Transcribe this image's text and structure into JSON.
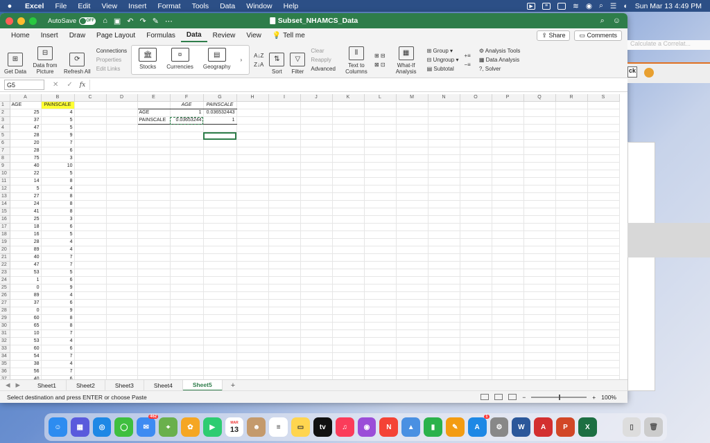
{
  "menubar": {
    "app": "Excel",
    "items": [
      "File",
      "Edit",
      "View",
      "Insert",
      "Format",
      "Tools",
      "Data",
      "Window",
      "Help"
    ],
    "clock": "Sun Mar 13  4:49 PM"
  },
  "titlebar": {
    "autosave_label": "AutoSave",
    "autosave_state": "OFF",
    "doc_title": "Subset_NHAMCS_Data"
  },
  "ribbon_tabs": [
    "Home",
    "Insert",
    "Draw",
    "Page Layout",
    "Formulas",
    "Data",
    "Review",
    "View"
  ],
  "tell_me": "Tell me",
  "share_label": "Share",
  "comments_label": "Comments",
  "ribbon": {
    "get_data": "Get Data",
    "data_from_picture": "Data from Picture",
    "refresh_all": "Refresh All",
    "connections": "Connections",
    "properties": "Properties",
    "edit_links": "Edit Links",
    "stocks": "Stocks",
    "currencies": "Currencies",
    "geography": "Geography",
    "sort": "Sort",
    "filter": "Filter",
    "clear": "Clear",
    "reapply": "Reapply",
    "advanced": "Advanced",
    "text_to_columns": "Text to Columns",
    "what_if": "What-If Analysis",
    "group": "Group",
    "ungroup": "Ungroup",
    "subtotal": "Subtotal",
    "analysis_tools": "Analysis Tools",
    "data_analysis": "Data Analysis",
    "solver": "Solver"
  },
  "formula_bar": {
    "name_box": "G5",
    "fx": "fx",
    "value": ""
  },
  "columns": [
    "A",
    "B",
    "C",
    "D",
    "E",
    "F",
    "G",
    "H",
    "I",
    "J",
    "K",
    "L",
    "M",
    "N",
    "O",
    "P",
    "Q",
    "R",
    "S"
  ],
  "header_row": {
    "A": "AGE",
    "B": "PAINSCALE"
  },
  "data_rows": [
    [
      25,
      4
    ],
    [
      37,
      5
    ],
    [
      47,
      5
    ],
    [
      28,
      9
    ],
    [
      20,
      7
    ],
    [
      28,
      6
    ],
    [
      75,
      3
    ],
    [
      40,
      10
    ],
    [
      22,
      5
    ],
    [
      14,
      8
    ],
    [
      5,
      4
    ],
    [
      27,
      8
    ],
    [
      24,
      8
    ],
    [
      41,
      8
    ],
    [
      25,
      3
    ],
    [
      18,
      6
    ],
    [
      16,
      5
    ],
    [
      28,
      4
    ],
    [
      89,
      4
    ],
    [
      40,
      7
    ],
    [
      47,
      7
    ],
    [
      53,
      5
    ],
    [
      1,
      6
    ],
    [
      0,
      9
    ],
    [
      89,
      4
    ],
    [
      37,
      6
    ],
    [
      0,
      9
    ],
    [
      60,
      8
    ],
    [
      65,
      8
    ],
    [
      10,
      7
    ],
    [
      53,
      4
    ],
    [
      60,
      6
    ],
    [
      54,
      7
    ],
    [
      38,
      4
    ],
    [
      56,
      7
    ],
    [
      40,
      6
    ]
  ],
  "correlation": {
    "col_labels": [
      "AGE",
      "PAINSCALE"
    ],
    "row_labels": [
      "AGE",
      "PAINSCALE"
    ],
    "r1": [
      "1",
      "0.036532443"
    ],
    "r2": [
      "0.03653244",
      "1"
    ]
  },
  "sheet_tabs": [
    "Sheet1",
    "Sheet2",
    "Sheet3",
    "Sheet4",
    "Sheet5"
  ],
  "active_sheet": "Sheet5",
  "status": {
    "message": "Select destination and press ENTER or choose Paste",
    "zoom": "100%"
  },
  "background": {
    "calc_hint": "Calculate a Correlat...",
    "k_label": "ck"
  },
  "dock": {
    "mail_badge": "462",
    "calendar_month": "MAR",
    "calendar_day": "13",
    "appstore_badge": "1"
  }
}
